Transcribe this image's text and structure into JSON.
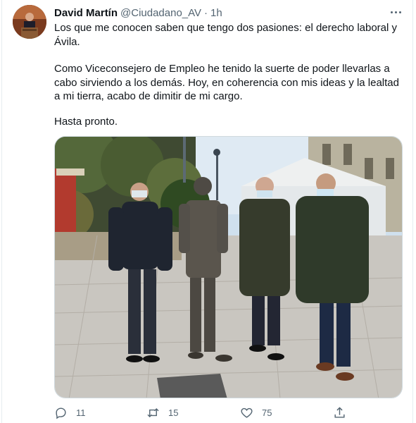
{
  "tweet": {
    "display_name": "David Martín",
    "handle": "@Ciudadano_AV",
    "separator": "·",
    "time": "1h",
    "paragraph_1": "Los que me conocen saben que tengo dos pasiones: el derecho laboral y Ávila.",
    "paragraph_2": "Como Viceconsejero de Empleo he tenido la suerte de poder llevarlas a cabo sirviendo a los demás. Hoy, en coherencia con mis ideas y la lealtad a mi tierra, acabo de dimitir de mi cargo.",
    "paragraph_3": "Hasta pronto."
  },
  "actions": {
    "replies": "11",
    "retweets": "15",
    "likes": "75"
  },
  "icons": {
    "more": "more-icon",
    "reply": "reply-icon",
    "retweet": "retweet-icon",
    "like": "heart-icon",
    "share": "share-icon"
  },
  "colors": {
    "text": "#0f1419",
    "secondary": "#536471",
    "border": "#cfd9de"
  }
}
